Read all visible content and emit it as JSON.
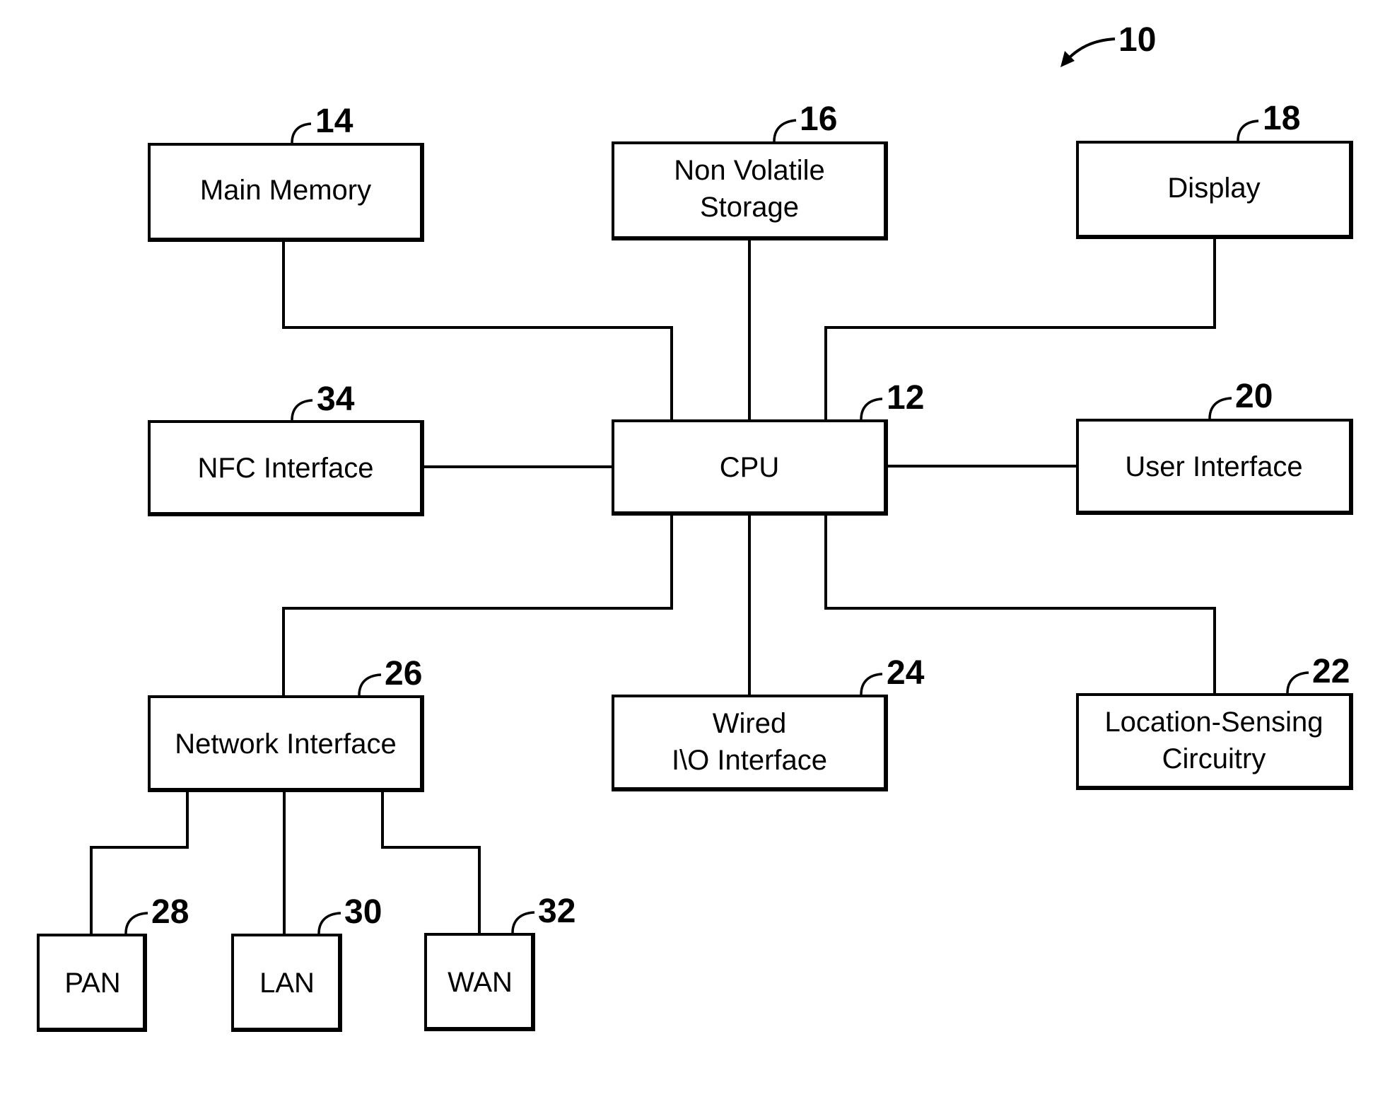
{
  "figure": {
    "reference": "10",
    "blocks": [
      {
        "id": "main-memory",
        "ref": "14",
        "lines": [
          "Main Memory"
        ]
      },
      {
        "id": "non-volatile-storage",
        "ref": "16",
        "lines": [
          "Non Volatile",
          "Storage"
        ]
      },
      {
        "id": "display",
        "ref": "18",
        "lines": [
          "Display"
        ]
      },
      {
        "id": "nfc-interface",
        "ref": "34",
        "lines": [
          "NFC Interface"
        ]
      },
      {
        "id": "cpu",
        "ref": "12",
        "lines": [
          "CPU"
        ]
      },
      {
        "id": "user-interface",
        "ref": "20",
        "lines": [
          "User Interface"
        ]
      },
      {
        "id": "network-interface",
        "ref": "26",
        "lines": [
          "Network Interface"
        ]
      },
      {
        "id": "wired-io-interface",
        "ref": "24",
        "lines": [
          "Wired",
          "I\\O Interface"
        ]
      },
      {
        "id": "location-sensing-circuitry",
        "ref": "22",
        "lines": [
          "Location-Sensing",
          "Circuitry"
        ]
      },
      {
        "id": "pan",
        "ref": "28",
        "lines": [
          "PAN"
        ]
      },
      {
        "id": "lan",
        "ref": "30",
        "lines": [
          "LAN"
        ]
      },
      {
        "id": "wan",
        "ref": "32",
        "lines": [
          "WAN"
        ]
      }
    ],
    "connections": [
      {
        "from": "cpu",
        "to": "main-memory"
      },
      {
        "from": "cpu",
        "to": "non-volatile-storage"
      },
      {
        "from": "cpu",
        "to": "display"
      },
      {
        "from": "cpu",
        "to": "nfc-interface"
      },
      {
        "from": "cpu",
        "to": "user-interface"
      },
      {
        "from": "cpu",
        "to": "network-interface"
      },
      {
        "from": "cpu",
        "to": "wired-io-interface"
      },
      {
        "from": "cpu",
        "to": "location-sensing-circuitry"
      },
      {
        "from": "network-interface",
        "to": "pan"
      },
      {
        "from": "network-interface",
        "to": "lan"
      },
      {
        "from": "network-interface",
        "to": "wan"
      }
    ]
  }
}
